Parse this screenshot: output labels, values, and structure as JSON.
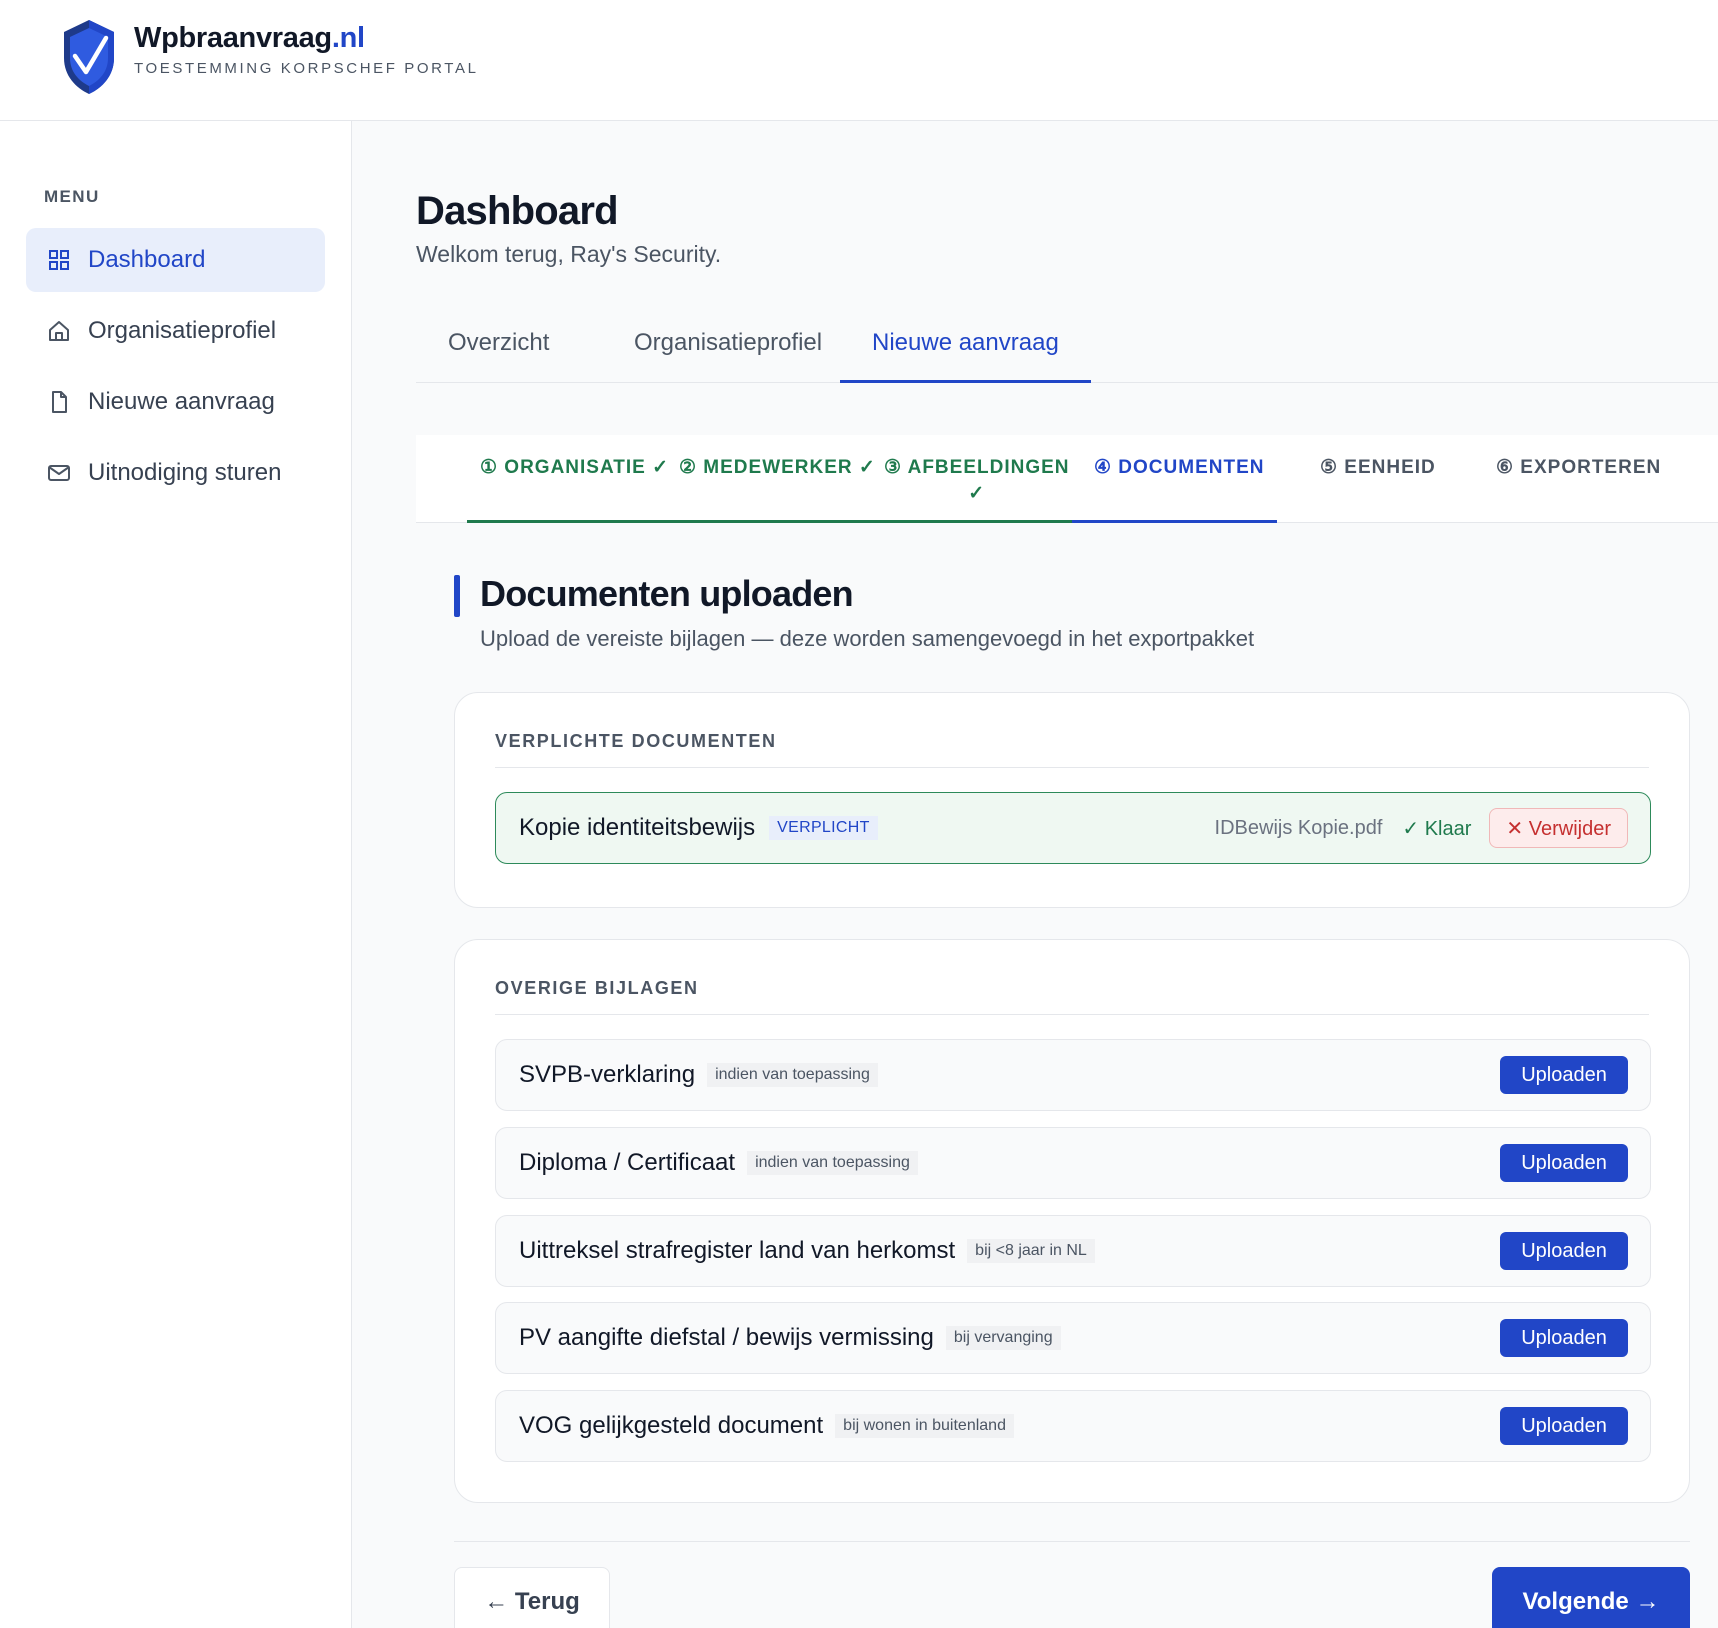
{
  "header": {
    "brand_name": "Wpbraanvraag",
    "brand_tld": ".nl",
    "brand_subtitle": "TOESTEMMING KORPSCHEF PORTAL",
    "logo_icon": "shield-check-icon"
  },
  "sidebar": {
    "menu_label": "MENU",
    "items": [
      {
        "label": "Dashboard",
        "icon": "grid-icon",
        "active": true
      },
      {
        "label": "Organisatieprofiel",
        "icon": "home-icon",
        "active": false
      },
      {
        "label": "Nieuwe aanvraag",
        "icon": "file-icon",
        "active": false
      },
      {
        "label": "Uitnodiging sturen",
        "icon": "mail-icon",
        "active": false
      }
    ]
  },
  "main": {
    "title": "Dashboard",
    "subtitle": "Welkom terug, Ray's Security.",
    "tabs": [
      {
        "label": "Overzicht",
        "active": false
      },
      {
        "label": "Organisatieprofiel",
        "active": false
      },
      {
        "label": "Nieuwe aanvraag",
        "active": true
      }
    ],
    "steps": [
      {
        "label": "① ORGANISATIE ✓",
        "state": "done"
      },
      {
        "label": "② MEDEWERKER ✓",
        "state": "done"
      },
      {
        "label": "③ AFBEELDINGEN",
        "check": "✓",
        "state": "done"
      },
      {
        "label": "④ DOCUMENTEN",
        "state": "current"
      },
      {
        "label": "⑤ EENHEID",
        "state": "todo"
      },
      {
        "label": "⑥ EXPORTEREN",
        "state": "todo"
      }
    ],
    "section": {
      "title": "Documenten uploaden",
      "subtitle": "Upload de vereiste bijlagen — deze worden samengevoegd in het exportpakket"
    },
    "required": {
      "heading": "VERPLICHTE DOCUMENTEN",
      "items": [
        {
          "name": "Kopie identiteitsbewijs",
          "tag": "VERPLICHT",
          "file": "IDBewijs Kopie.pdf",
          "status": "✓ Klaar",
          "remove_label": "✕ Verwijder"
        }
      ]
    },
    "optional": {
      "heading": "OVERIGE BIJLAGEN",
      "upload_label": "Uploaden",
      "items": [
        {
          "name": "SVPB-verklaring",
          "tag": "indien van toepassing"
        },
        {
          "name": "Diploma / Certificaat",
          "tag": "indien van toepassing"
        },
        {
          "name": "Uittreksel strafregister land van herkomst",
          "tag": "bij <8 jaar in NL"
        },
        {
          "name": "PV aangifte diefstal / bewijs vermissing",
          "tag": "bij vervanging"
        },
        {
          "name": "VOG gelijkgesteld document",
          "tag": "bij wonen in buitenland"
        }
      ]
    },
    "footer": {
      "back_label": "← Terug",
      "next_label": "Volgende →"
    }
  },
  "colors": {
    "accent": "#2146c7",
    "success": "#1f7a4d",
    "danger": "#c53030"
  }
}
